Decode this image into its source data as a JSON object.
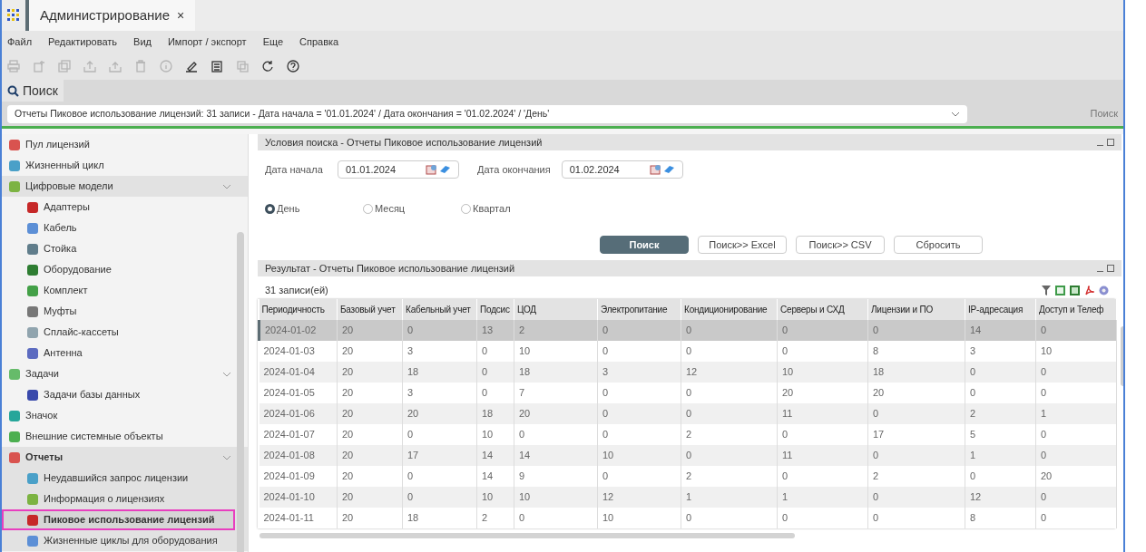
{
  "window": {
    "tab_title": "Администрирование",
    "tab_close": "×"
  },
  "menu": [
    "Файл",
    "Редактировать",
    "Вид",
    "Импорт / экспорт",
    "Еще",
    "Справка"
  ],
  "toolbar": [
    {
      "disabled": true
    },
    {
      "disabled": true
    },
    {
      "disabled": true
    },
    {
      "disabled": true
    },
    {
      "disabled": true
    },
    {
      "disabled": true
    },
    {
      "disabled": true
    },
    {
      "disabled": false
    },
    {
      "disabled": false
    },
    {
      "disabled": true
    },
    {
      "disabled": false
    },
    {
      "disabled": false
    }
  ],
  "search_tab": {
    "label": "Поиск"
  },
  "summary": {
    "value": "Отчеты Пиковое использование лицензий: 31 записи - Дата начала = '01.01.2024' / Дата окончания = '01.02.2024' / 'День'",
    "action": "Поиск"
  },
  "sidebar": {
    "items": [
      {
        "label": "Пул лицензий",
        "highlighted": false,
        "selected": false
      },
      {
        "label": "Жизненный цикл",
        "highlighted": false,
        "selected": false
      },
      {
        "label": "Цифровые модели",
        "highlighted": true,
        "selected": false,
        "expanded": true,
        "children": [
          {
            "label": "Адаптеры",
            "selected": false
          },
          {
            "label": "Кабель",
            "selected": false
          },
          {
            "label": "Стойка",
            "selected": false
          },
          {
            "label": "Оборудование",
            "selected": false
          },
          {
            "label": "Комплект",
            "selected": false
          },
          {
            "label": "Муфты",
            "selected": false
          },
          {
            "label": "Сплайс-кассеты",
            "selected": false
          },
          {
            "label": "Антенна",
            "selected": false
          }
        ]
      },
      {
        "label": "Задачи",
        "highlighted": false,
        "selected": false,
        "expanded": true,
        "children": [
          {
            "label": "Задачи базы данных",
            "selected": false
          }
        ]
      },
      {
        "label": "Значок",
        "highlighted": false,
        "selected": false
      },
      {
        "label": "Внешние системные объекты",
        "highlighted": false,
        "selected": false
      },
      {
        "label": "Отчеты",
        "highlighted": true,
        "selected": false,
        "expanded": true,
        "children": [
          {
            "label": "Неудавшийся запрос лицензии",
            "selected": false
          },
          {
            "label": "Информация о лицензиях",
            "selected": false
          },
          {
            "label": "Пиковое использование лицензий",
            "selected": true
          },
          {
            "label": "Жизненные циклы для оборудования",
            "selected": false
          }
        ]
      }
    ]
  },
  "conditions": {
    "title": "Условия поиска - Отчеты Пиковое использование лицензий",
    "fields": [
      {
        "label": "Дата начала",
        "value": "01.01.2024"
      },
      {
        "label": "Дата окончания",
        "value": "01.02.2024"
      }
    ],
    "periods": [
      {
        "label": "День",
        "selected": true
      },
      {
        "label": "Месяц",
        "selected": false
      },
      {
        "label": "Квартал",
        "selected": false
      }
    ],
    "buttons": [
      {
        "label": "Поиск",
        "kind": "primary"
      },
      {
        "label": "Поиск>> Excel",
        "kind": "secondary"
      },
      {
        "label": "Поиск>> CSV",
        "kind": "secondary"
      },
      {
        "label": "Сбросить",
        "kind": "secondary"
      }
    ]
  },
  "result": {
    "title": "Результат - Отчеты Пиковое использование лицензий",
    "count": "31 записи(ей)",
    "table": {
      "columns": [
        "Периодичность",
        "Базовый учет",
        "Кабельный учет",
        "Подсис",
        "ЦОД",
        "Электропитание",
        "Кондиционирование",
        "Серверы и СХД",
        "Лицензии и ПО",
        "IP-адресация",
        "Доступ и Телеф"
      ],
      "rows": [
        {
          "selected": true,
          "cells": [
            "2024-01-02",
            "20",
            "0",
            "13",
            "2",
            "0",
            "0",
            "0",
            "0",
            "14",
            "0"
          ]
        },
        {
          "selected": false,
          "cells": [
            "2024-01-03",
            "20",
            "3",
            "0",
            "10",
            "0",
            "0",
            "0",
            "8",
            "3",
            "10"
          ]
        },
        {
          "selected": false,
          "cells": [
            "2024-01-04",
            "20",
            "18",
            "0",
            "18",
            "3",
            "12",
            "10",
            "18",
            "0",
            "0"
          ]
        },
        {
          "selected": false,
          "cells": [
            "2024-01-05",
            "20",
            "3",
            "0",
            "7",
            "0",
            "0",
            "20",
            "20",
            "0",
            "0"
          ]
        },
        {
          "selected": false,
          "cells": [
            "2024-01-06",
            "20",
            "20",
            "18",
            "20",
            "0",
            "0",
            "11",
            "0",
            "2",
            "1"
          ]
        },
        {
          "selected": false,
          "cells": [
            "2024-01-07",
            "20",
            "0",
            "10",
            "0",
            "0",
            "2",
            "0",
            "17",
            "5",
            "0"
          ]
        },
        {
          "selected": false,
          "cells": [
            "2024-01-08",
            "20",
            "17",
            "14",
            "14",
            "10",
            "0",
            "11",
            "0",
            "1",
            "0"
          ]
        },
        {
          "selected": false,
          "cells": [
            "2024-01-09",
            "20",
            "0",
            "14",
            "9",
            "0",
            "2",
            "0",
            "2",
            "0",
            "20"
          ]
        },
        {
          "selected": false,
          "cells": [
            "2024-01-10",
            "20",
            "0",
            "10",
            "10",
            "12",
            "1",
            "1",
            "0",
            "12",
            "0"
          ]
        },
        {
          "selected": false,
          "cells": [
            "2024-01-11",
            "20",
            "18",
            "2",
            "0",
            "10",
            "0",
            "0",
            "0",
            "8",
            "0"
          ]
        }
      ]
    }
  }
}
